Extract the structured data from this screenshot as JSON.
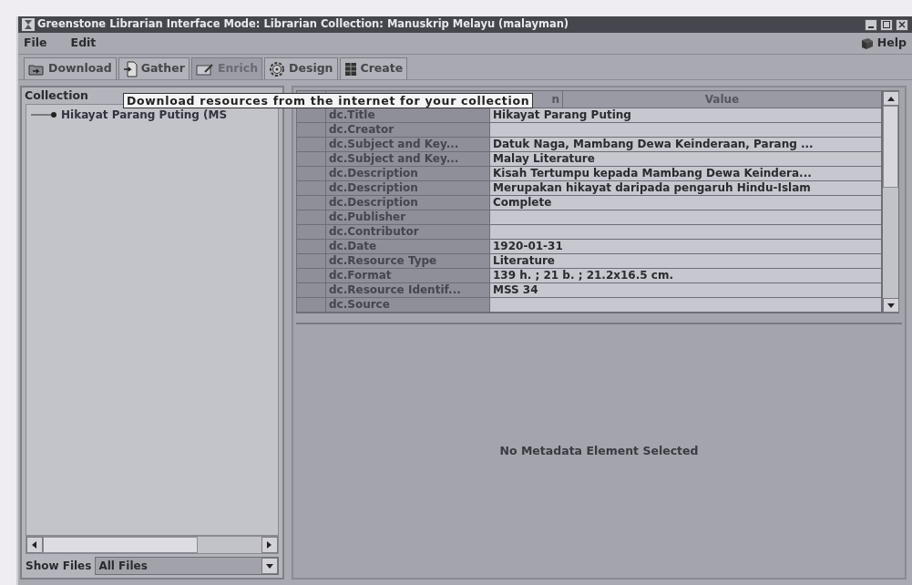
{
  "window": {
    "title": "Greenstone Librarian Interface  Mode: Librarian  Collection: Manuskrip Melayu (malayman)"
  },
  "menu": [
    "File",
    "Edit"
  ],
  "help": "Help",
  "tabs": [
    {
      "kind": "download",
      "label": "Download",
      "selected": false
    },
    {
      "kind": "gather",
      "label": "Gather",
      "selected": false
    },
    {
      "kind": "enrich",
      "label": "Enrich",
      "selected": true
    },
    {
      "kind": "design",
      "label": "Design",
      "selected": false
    },
    {
      "kind": "create",
      "label": "Create",
      "selected": false
    }
  ],
  "tooltip": "Download resources from the internet for your collection",
  "collection_panel": {
    "title": "Collection",
    "tree": [
      {
        "label": "Hikayat Parang Puting (MS"
      }
    ],
    "show_files_label": "Show Files",
    "show_files_value": "All Files"
  },
  "metadata_table": {
    "columns": [
      "n",
      "Value"
    ],
    "rows": [
      {
        "element": "dc.Title",
        "value": "Hikayat Parang Puting"
      },
      {
        "element": "dc.Creator",
        "value": ""
      },
      {
        "element": "dc.Subject and Key...",
        "value": "Datuk Naga, Mambang Dewa Keinderaan, Parang ..."
      },
      {
        "element": "dc.Subject and Key...",
        "value": "Malay Literature"
      },
      {
        "element": "dc.Description",
        "value": "Kisah Tertumpu kepada Mambang Dewa Keindera..."
      },
      {
        "element": "dc.Description",
        "value": "Merupakan hikayat daripada pengaruh Hindu-Islam"
      },
      {
        "element": "dc.Description",
        "value": "Complete"
      },
      {
        "element": "dc.Publisher",
        "value": ""
      },
      {
        "element": "dc.Contributor",
        "value": ""
      },
      {
        "element": "dc.Date",
        "value": "1920-01-31"
      },
      {
        "element": "dc.Resource Type",
        "value": "Literature"
      },
      {
        "element": "dc.Format",
        "value": "139 h. ; 21 b. ; 21.2x16.5 cm."
      },
      {
        "element": "dc.Resource Identif...",
        "value": "MSS 34"
      },
      {
        "element": "dc.Source",
        "value": ""
      }
    ]
  },
  "detail_panel": {
    "message": "No Metadata Element Selected"
  }
}
